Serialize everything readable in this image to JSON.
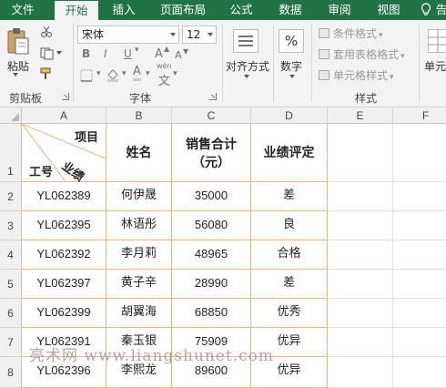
{
  "tabs": [
    {
      "label": "文件"
    },
    {
      "label": "开始"
    },
    {
      "label": "插入"
    },
    {
      "label": "页面布局"
    },
    {
      "label": "公式"
    },
    {
      "label": "数据"
    },
    {
      "label": "审阅"
    },
    {
      "label": "视图"
    },
    {
      "label": "告"
    }
  ],
  "ribbon": {
    "clipboard": {
      "paste_label": "粘贴",
      "group_label": "剪贴板"
    },
    "font": {
      "name": "宋体",
      "size": "12",
      "group_label": "字体",
      "bold": "B",
      "italic": "I",
      "underline": "U",
      "grow": "A",
      "shrink": "A",
      "font_color": "A",
      "phonetic": "wén"
    },
    "alignment": {
      "label": "对齐方式"
    },
    "number": {
      "label": "数字",
      "symbol": "%"
    },
    "styles": {
      "conditional": "条件格式",
      "table": "套用表格格式",
      "cell": "单元格样式",
      "group_label": "样式"
    },
    "cells": {
      "label": "单元"
    }
  },
  "columns": [
    "A",
    "B",
    "C",
    "D",
    "E",
    "F"
  ],
  "rows": [
    "1",
    "2",
    "3",
    "4",
    "5",
    "6",
    "7",
    "8"
  ],
  "table": {
    "diag_item": "项目",
    "diag_perf": "业绩",
    "diag_id": "工号",
    "name_header": "姓名",
    "sales_header_line1": "销售合计",
    "sales_header_line2": "（元）",
    "rating_header": "业绩评定",
    "data": [
      {
        "id": "YL062389",
        "name": "何伊晟",
        "sales": "35000",
        "rating": "差"
      },
      {
        "id": "YL062395",
        "name": "林语彤",
        "sales": "56080",
        "rating": "良"
      },
      {
        "id": "YL062392",
        "name": "李月莉",
        "sales": "48965",
        "rating": "合格"
      },
      {
        "id": "YL062397",
        "name": "黄子辛",
        "sales": "28990",
        "rating": "差"
      },
      {
        "id": "YL062399",
        "name": "胡翼海",
        "sales": "68850",
        "rating": "优秀"
      },
      {
        "id": "YL062391",
        "name": "秦玉银",
        "sales": "75909",
        "rating": "优异"
      },
      {
        "id": "YL062396",
        "name": "李熙龙",
        "sales": "89600",
        "rating": "优异"
      }
    ]
  },
  "watermark": "亮术网 www.liangshunet.com",
  "colors": {
    "excel_green": "#217346",
    "border_orange": "#f4b183"
  }
}
